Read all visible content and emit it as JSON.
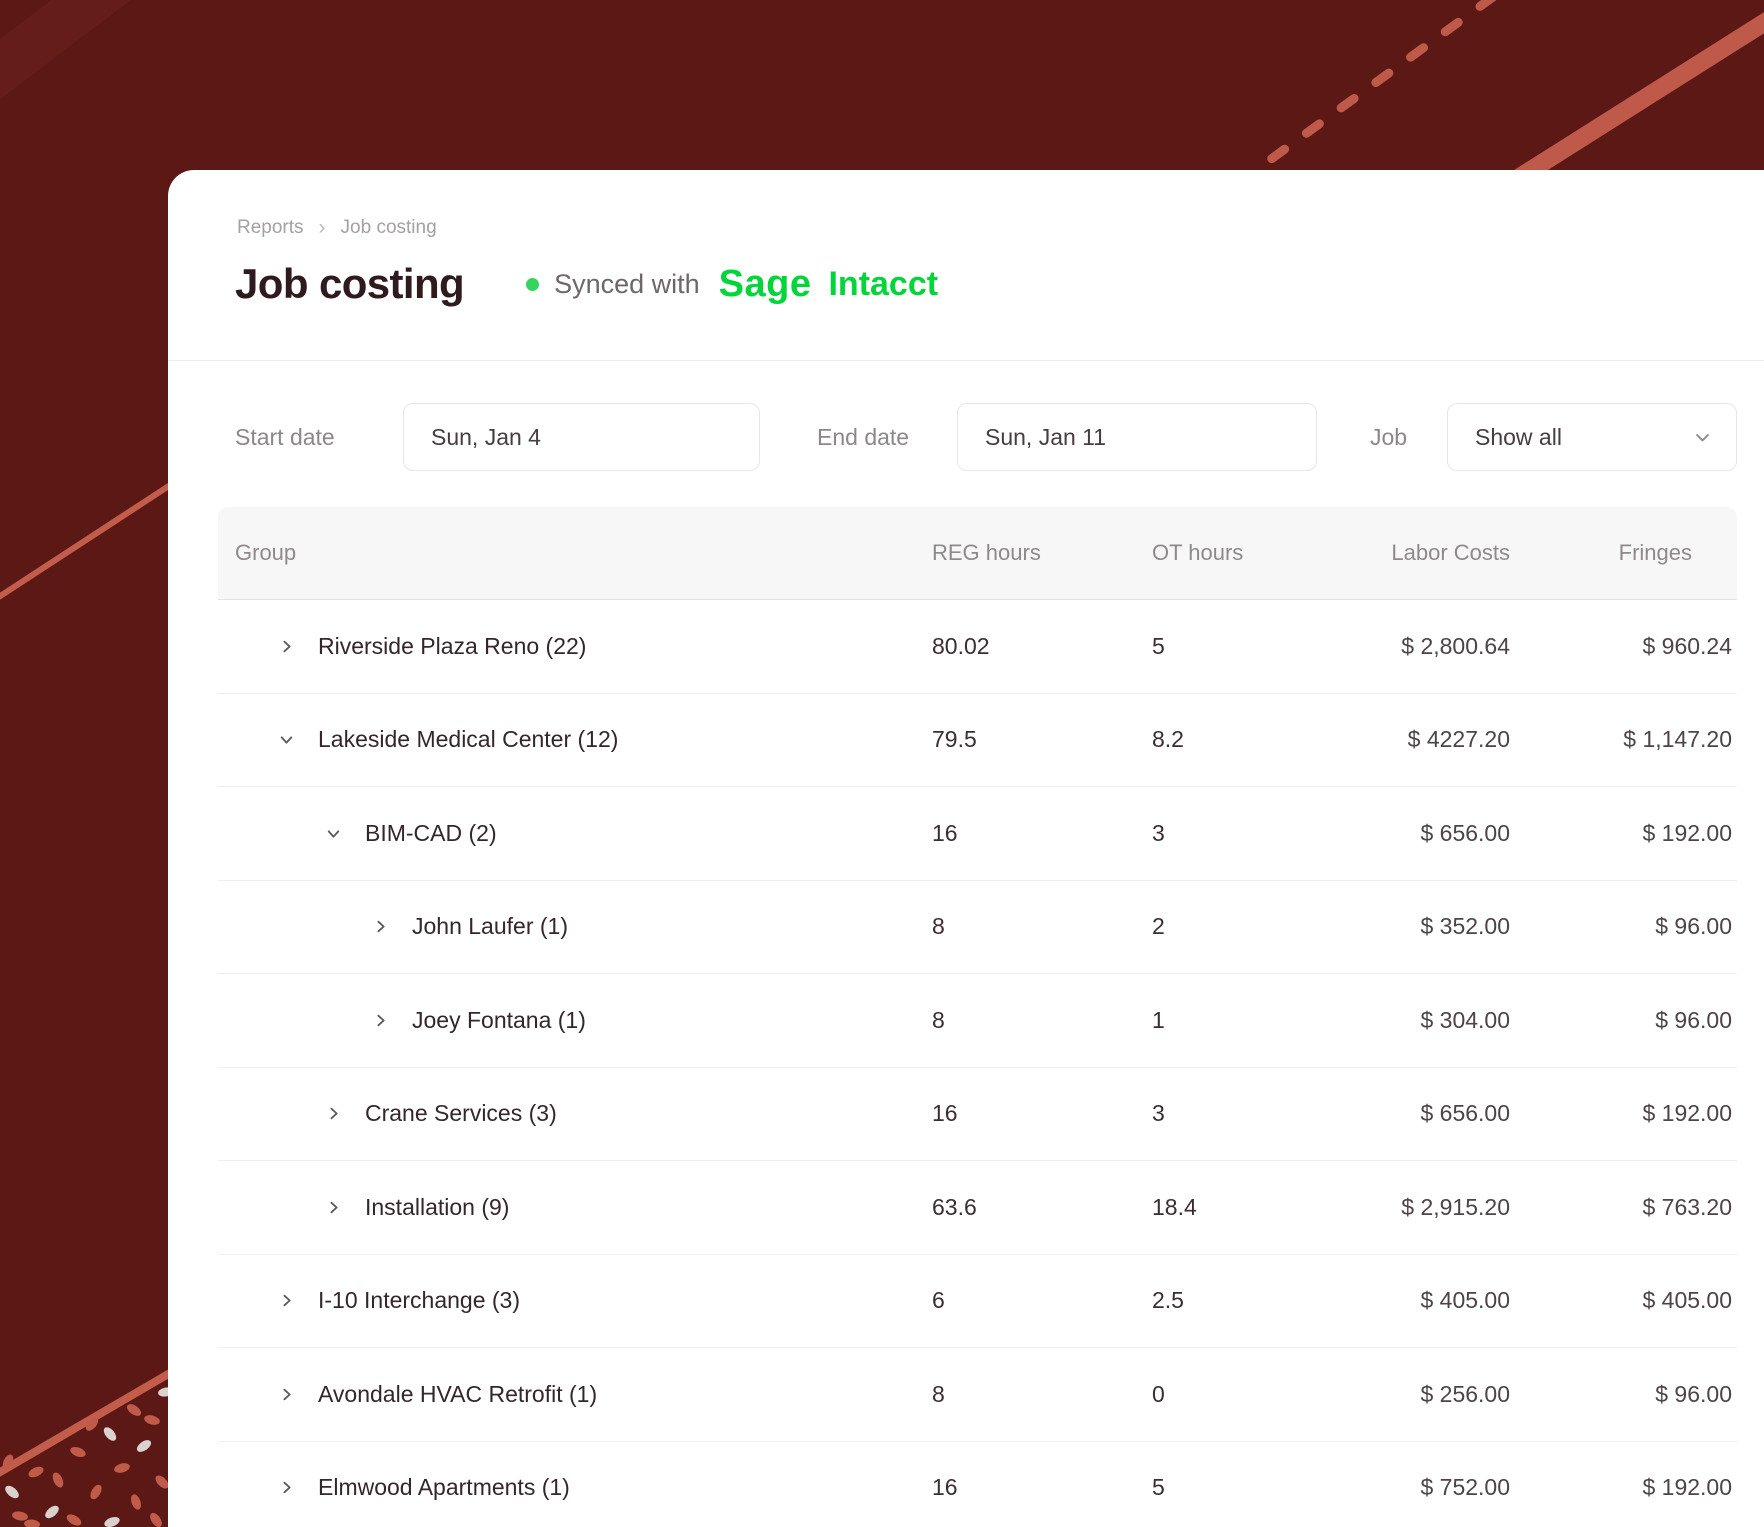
{
  "breadcrumb": {
    "items": [
      "Reports",
      "Job costing"
    ],
    "separator": "›"
  },
  "header": {
    "title": "Job costing",
    "sync_text": "Synced with",
    "sync_brand": "Sage",
    "sync_product": "Intacct"
  },
  "filters": {
    "start_date": {
      "label": "Start date",
      "value": "Sun, Jan 4"
    },
    "end_date": {
      "label": "End date",
      "value": "Sun, Jan 11"
    },
    "job": {
      "label": "Job",
      "value": "Show all"
    }
  },
  "table": {
    "columns": [
      "Group",
      "REG hours",
      "OT hours",
      "Labor Costs",
      "Fringes"
    ],
    "rows": [
      {
        "label": "Riverside Plaza Reno (22)",
        "level": 0,
        "expanded": false,
        "reg": "80.02",
        "ot": "5",
        "labor": "$ 2,800.64",
        "fringes": "$ 960.24"
      },
      {
        "label": "Lakeside Medical Center (12)",
        "level": 0,
        "expanded": true,
        "reg": "79.5",
        "ot": "8.2",
        "labor": "$ 4227.20",
        "fringes": "$ 1,147.20"
      },
      {
        "label": "BIM-CAD (2)",
        "level": 1,
        "expanded": true,
        "reg": "16",
        "ot": "3",
        "labor": "$ 656.00",
        "fringes": "$ 192.00"
      },
      {
        "label": "John Laufer (1)",
        "level": 2,
        "expanded": false,
        "reg": "8",
        "ot": "2",
        "labor": "$ 352.00",
        "fringes": "$ 96.00"
      },
      {
        "label": "Joey Fontana (1)",
        "level": 2,
        "expanded": false,
        "reg": "8",
        "ot": "1",
        "labor": "$ 304.00",
        "fringes": "$ 96.00"
      },
      {
        "label": "Crane Services (3)",
        "level": 1,
        "expanded": false,
        "reg": "16",
        "ot": "3",
        "labor": "$ 656.00",
        "fringes": "$ 192.00"
      },
      {
        "label": "Installation (9)",
        "level": 1,
        "expanded": false,
        "reg": "63.6",
        "ot": "18.4",
        "labor": "$ 2,915.20",
        "fringes": "$ 763.20"
      },
      {
        "label": "I-10 Interchange (3)",
        "level": 0,
        "expanded": false,
        "reg": "6",
        "ot": "2.5",
        "labor": "$ 405.00",
        "fringes": "$ 405.00"
      },
      {
        "label": "Avondale HVAC Retrofit (1)",
        "level": 0,
        "expanded": false,
        "reg": "8",
        "ot": "0",
        "labor": "$ 256.00",
        "fringes": "$ 96.00"
      },
      {
        "label": "Elmwood Apartments (1)",
        "level": 0,
        "expanded": false,
        "reg": "16",
        "ot": "5",
        "labor": "$ 752.00",
        "fringes": "$ 192.00"
      }
    ]
  },
  "colors": {
    "background": "#5C1815",
    "accent_stripe": "#C05A4A",
    "brand_green": "#00D639",
    "status_dot_green": "#35D35F"
  }
}
